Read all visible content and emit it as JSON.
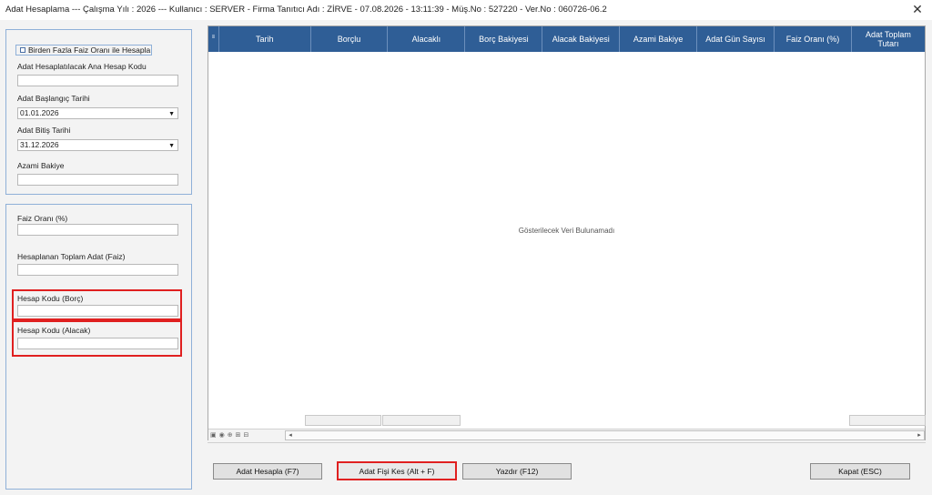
{
  "window": {
    "title": "Adat Hesaplama  ---  Çalışma Yılı : 2026  ---  Kullanıcı : SERVER - Firma Tanıtıcı Adı : ZİRVE - 07.08.2026 - 13:11:39 - Müş.No : 527220 - Ver.No : 060726-06.2",
    "close_glyph": "✕"
  },
  "top_panel": {
    "checkbox_label": "Birden Fazla Faiz Oranı ile Hesapla",
    "account_code_label": "Adat Hesaplatılacak Ana Hesap Kodu",
    "account_code_value": "",
    "start_date_label": "Adat Başlangıç Tarihi",
    "start_date_value": "01.01.2026",
    "end_date_label": "Adat Bitiş Tarihi",
    "end_date_value": "31.12.2026",
    "max_balance_label": "Azami Bakiye",
    "max_balance_value": ""
  },
  "bottom_panel": {
    "interest_rate_label": "Faiz Oranı (%)",
    "interest_rate_value": "",
    "total_adat_label": "Hesaplanan Toplam Adat (Faiz)",
    "total_adat_value": "",
    "debit_account_label": "Hesap Kodu (Borç)",
    "debit_account_value": "",
    "credit_account_label": "Hesap Kodu (Alacak)",
    "credit_account_value": ""
  },
  "grid": {
    "columns": [
      "Tarih",
      "Borçlu",
      "Alacaklı",
      "Borç Bakiyesi",
      "Alacak Bakiyesi",
      "Azami Bakiye",
      "Adat Gün Sayısı",
      "Faiz Oranı (%)",
      "Adat Toplam Tutarı"
    ],
    "empty_message": "Gösterilecek Veri Bulunamadı"
  },
  "buttons": {
    "calculate": "Adat Hesapla (F7)",
    "create_voucher": "Adat Fişi Kes (Alt + F)",
    "print": "Yazdır (F12)",
    "close": "Kapat (ESC)"
  },
  "colors": {
    "header_bg": "#2f5e96",
    "highlight": "#e02020",
    "panel_border": "#8fb0d8"
  }
}
